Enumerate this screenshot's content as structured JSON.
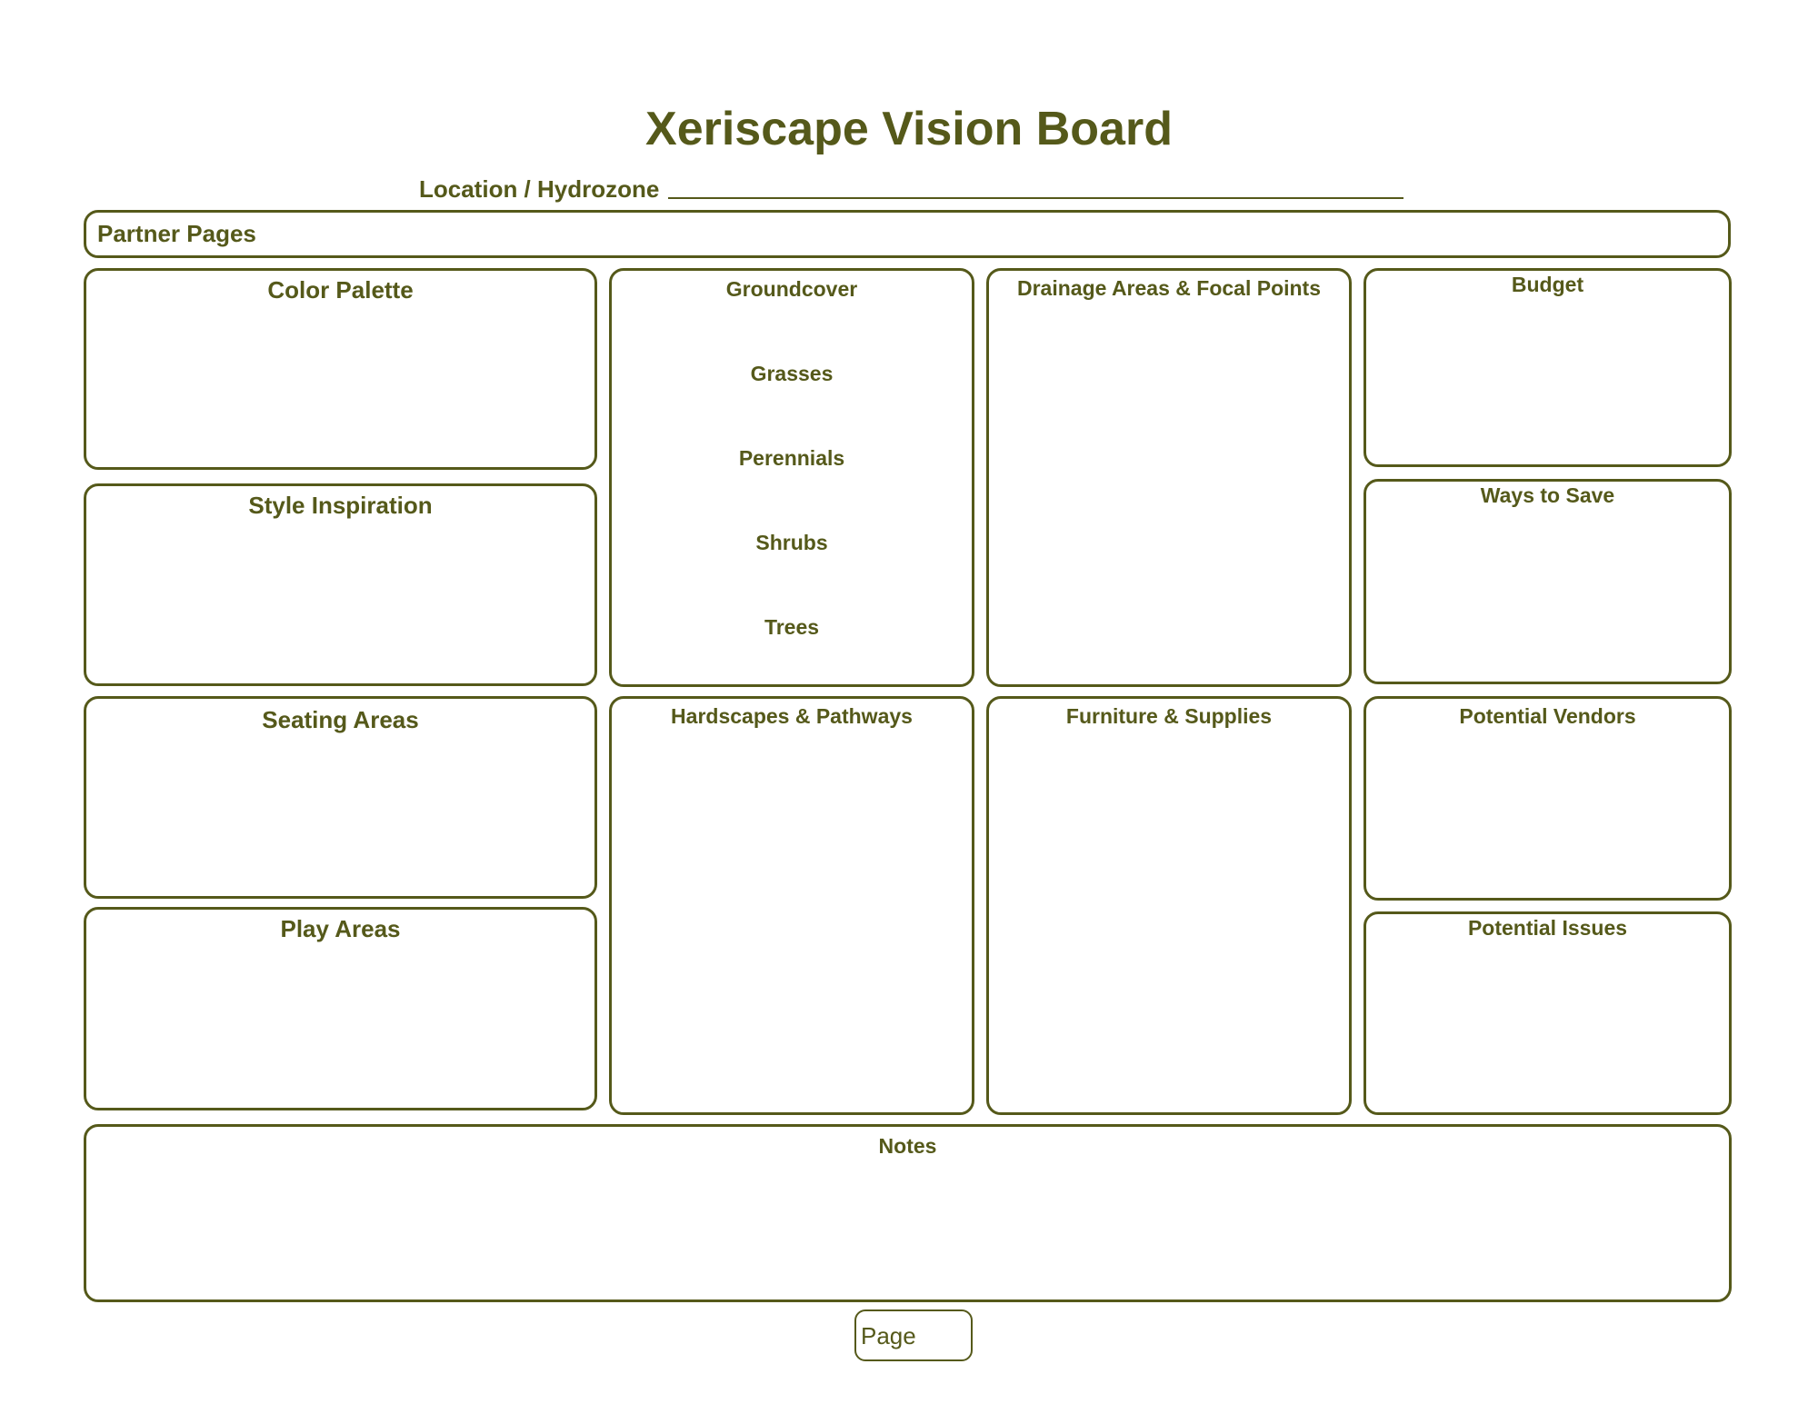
{
  "title": "Xeriscape Vision Board",
  "location": {
    "label": "Location / Hydrozone"
  },
  "partner_pages": {
    "label": "Partner Pages"
  },
  "sections": {
    "color_palette": "Color Palette",
    "style_inspiration": "Style Inspiration",
    "seating_areas": "Seating Areas",
    "play_areas": "Play Areas",
    "plants": {
      "groundcover": "Groundcover",
      "grasses": "Grasses",
      "perennials": "Perennials",
      "shrubs": "Shrubs",
      "trees": "Trees"
    },
    "hardscapes": "Hardscapes & Pathways",
    "drainage": "Drainage Areas & Focal Points",
    "furniture": "Furniture & Supplies",
    "budget": "Budget",
    "ways_to_save": "Ways to Save",
    "vendors": "Potential Vendors",
    "issues": "Potential Issues",
    "notes": "Notes"
  },
  "footer": {
    "page_label": "Page"
  },
  "colors": {
    "accent": "#55591a",
    "background": "#ffffff"
  }
}
